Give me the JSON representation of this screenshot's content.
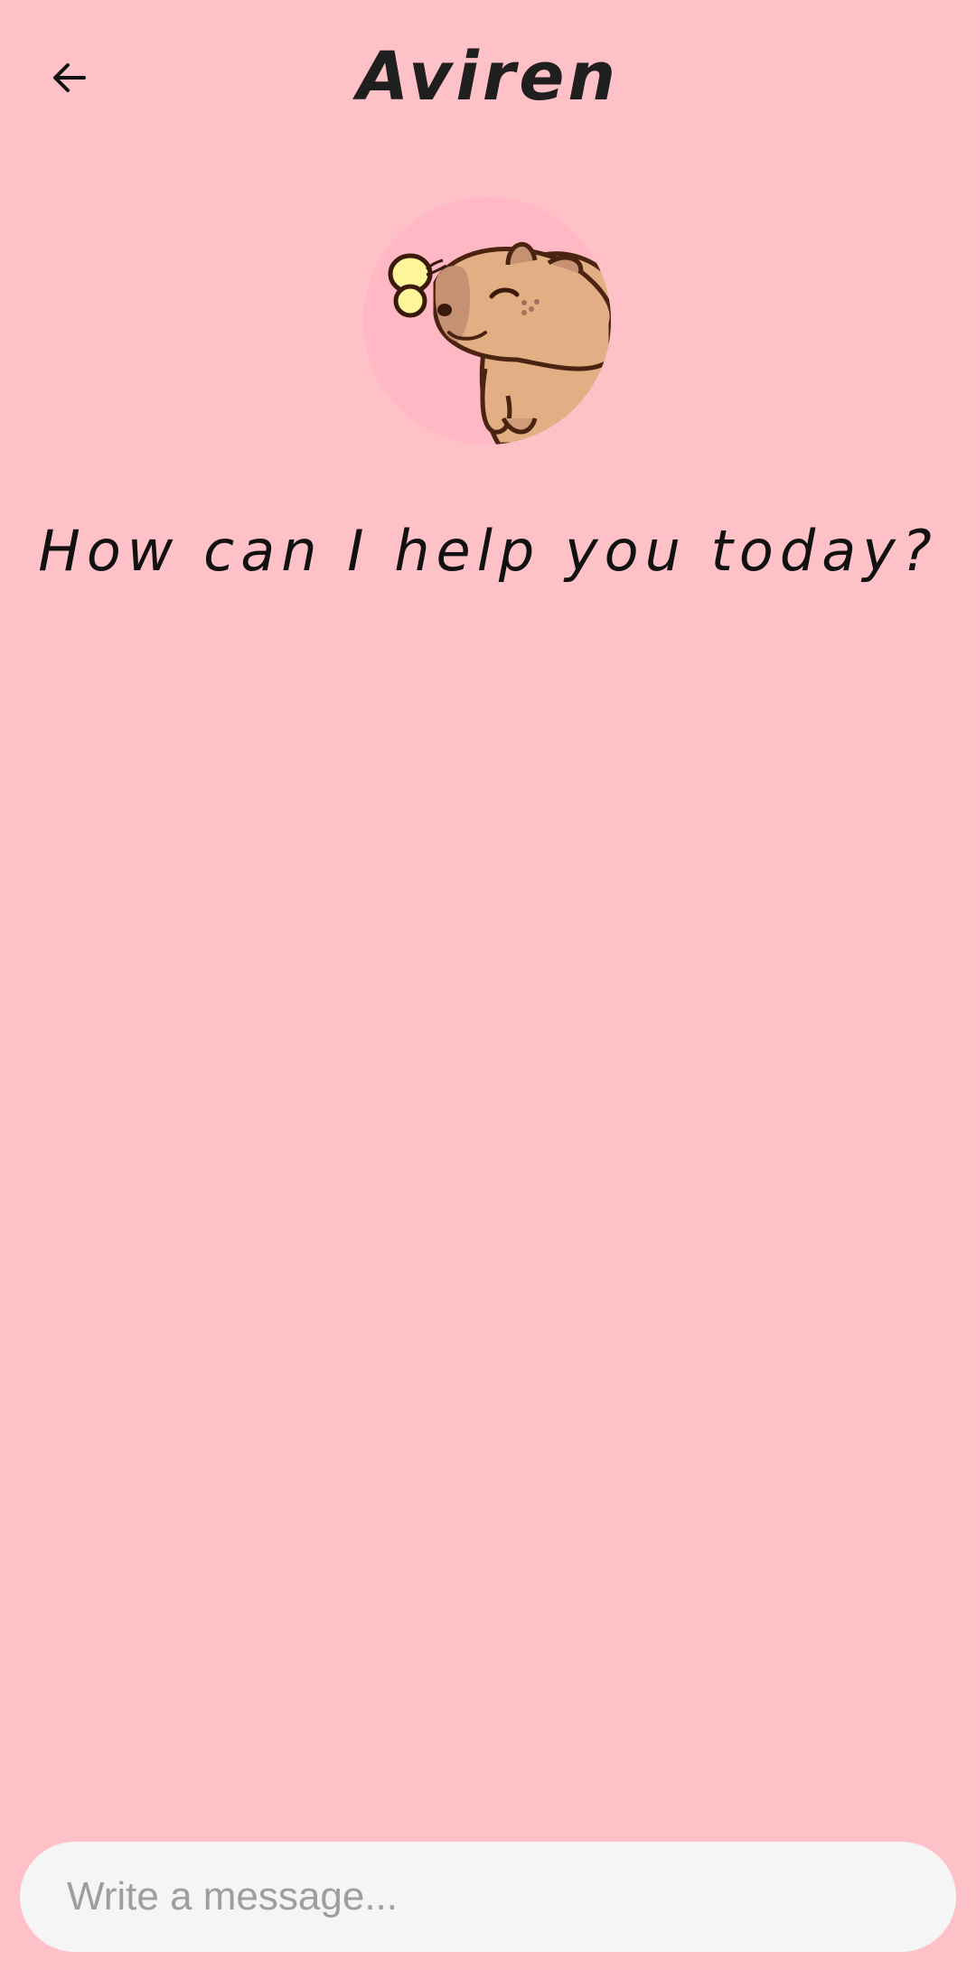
{
  "header": {
    "back_icon": "arrow-left-icon",
    "title": "Aviren"
  },
  "assistant": {
    "avatar": "capybara-with-butterfly-illustration",
    "greeting": "How can I help you today?"
  },
  "composer": {
    "placeholder": "Write a message...",
    "value": ""
  },
  "colors": {
    "background": "#FFC1C8",
    "avatar_circle": "#FFB8C4",
    "input_background": "#F5F5F5",
    "placeholder_text": "#9E9E9E",
    "title_text": "#1F1F1F"
  }
}
